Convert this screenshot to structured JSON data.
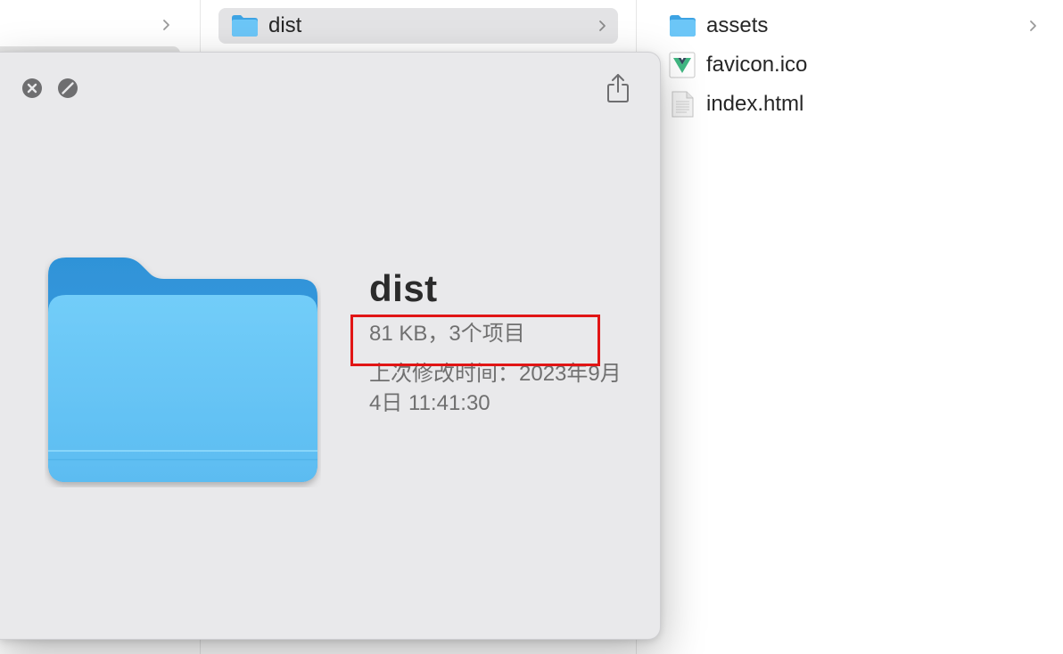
{
  "finder": {
    "middle_column": {
      "selected_item": {
        "label": "dist",
        "icon": "folder-icon"
      }
    },
    "right_column": {
      "items": [
        {
          "label": "assets",
          "icon": "folder-icon"
        },
        {
          "label": "favicon.ico",
          "icon": "vue-logo-icon"
        },
        {
          "label": "index.html",
          "icon": "document-icon"
        }
      ]
    }
  },
  "quicklook": {
    "title": "dist",
    "summary": "81 KB，3个项目",
    "modified": "上次修改时间：2023年9月4日 11:41:30",
    "buttons": {
      "close_icon": "close-icon",
      "fullscreen_icon": "fullscreen-icon",
      "share_icon": "share-icon"
    }
  },
  "colors": {
    "folder_blue": "#5bb9ef",
    "highlight_red": "#e11515"
  }
}
